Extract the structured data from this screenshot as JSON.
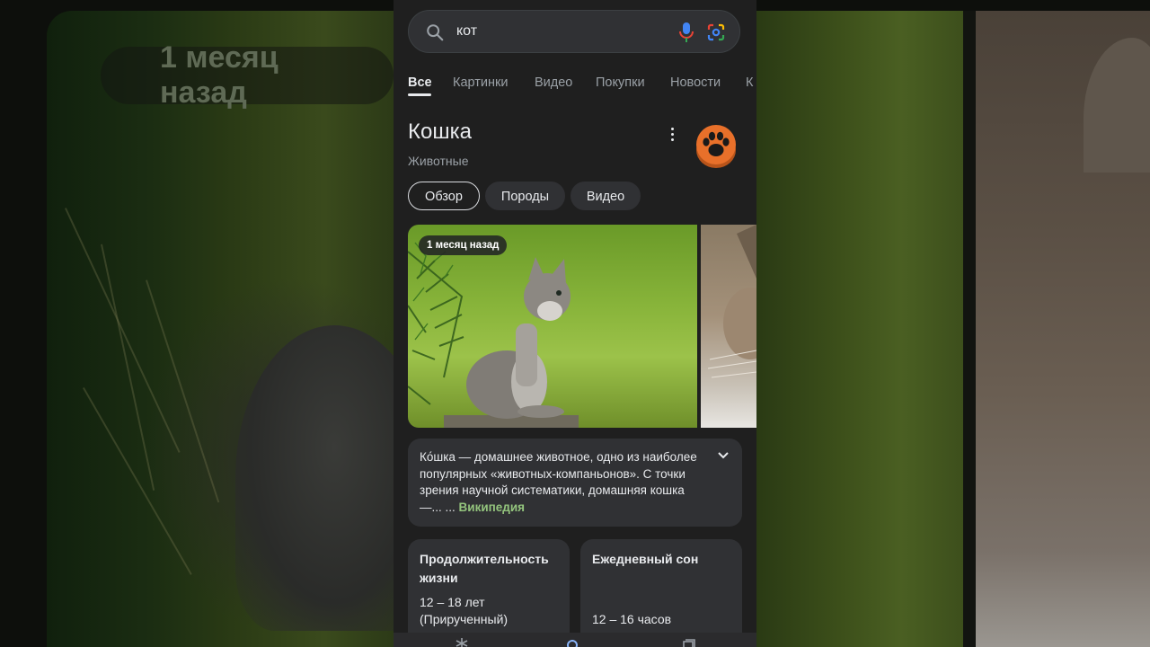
{
  "background": {
    "badge_text": "1 месяц назад"
  },
  "search": {
    "query": "кот"
  },
  "tabs": [
    {
      "label": "Все",
      "active": true
    },
    {
      "label": "Картинки"
    },
    {
      "label": "Видео"
    },
    {
      "label": "Покупки"
    },
    {
      "label": "Новости"
    },
    {
      "label": "К"
    }
  ],
  "knowledge_panel": {
    "title": "Кошка",
    "subtitle": "Животные",
    "chips": [
      {
        "label": "Обзор",
        "active": true
      },
      {
        "label": "Породы"
      },
      {
        "label": "Видео"
      }
    ],
    "image_badge": "1 месяц назад",
    "description": "Ко́шка — домашнее животное, одно из наиболее популярных «животных-компаньонов». С точки зрения научной систематики, домашняя кошка —... ...",
    "source_link": "Википедия",
    "facts": [
      {
        "label": "Продолжительность жизни",
        "value": "12 – 18 лет (Прирученный)"
      },
      {
        "label": "Ежедневный сон",
        "value": "12 – 16 часов"
      }
    ]
  },
  "icons": {
    "search": "search-icon",
    "mic": "microphone-icon",
    "lens": "google-lens-icon",
    "more": "more-vert-icon",
    "avatar": "paw-icon",
    "expand": "chevron-down-icon"
  },
  "colors": {
    "panel_bg": "#1f1f1f",
    "card_bg": "#303134",
    "link_green": "#93c47d",
    "avatar_orange": "#e8702a"
  }
}
